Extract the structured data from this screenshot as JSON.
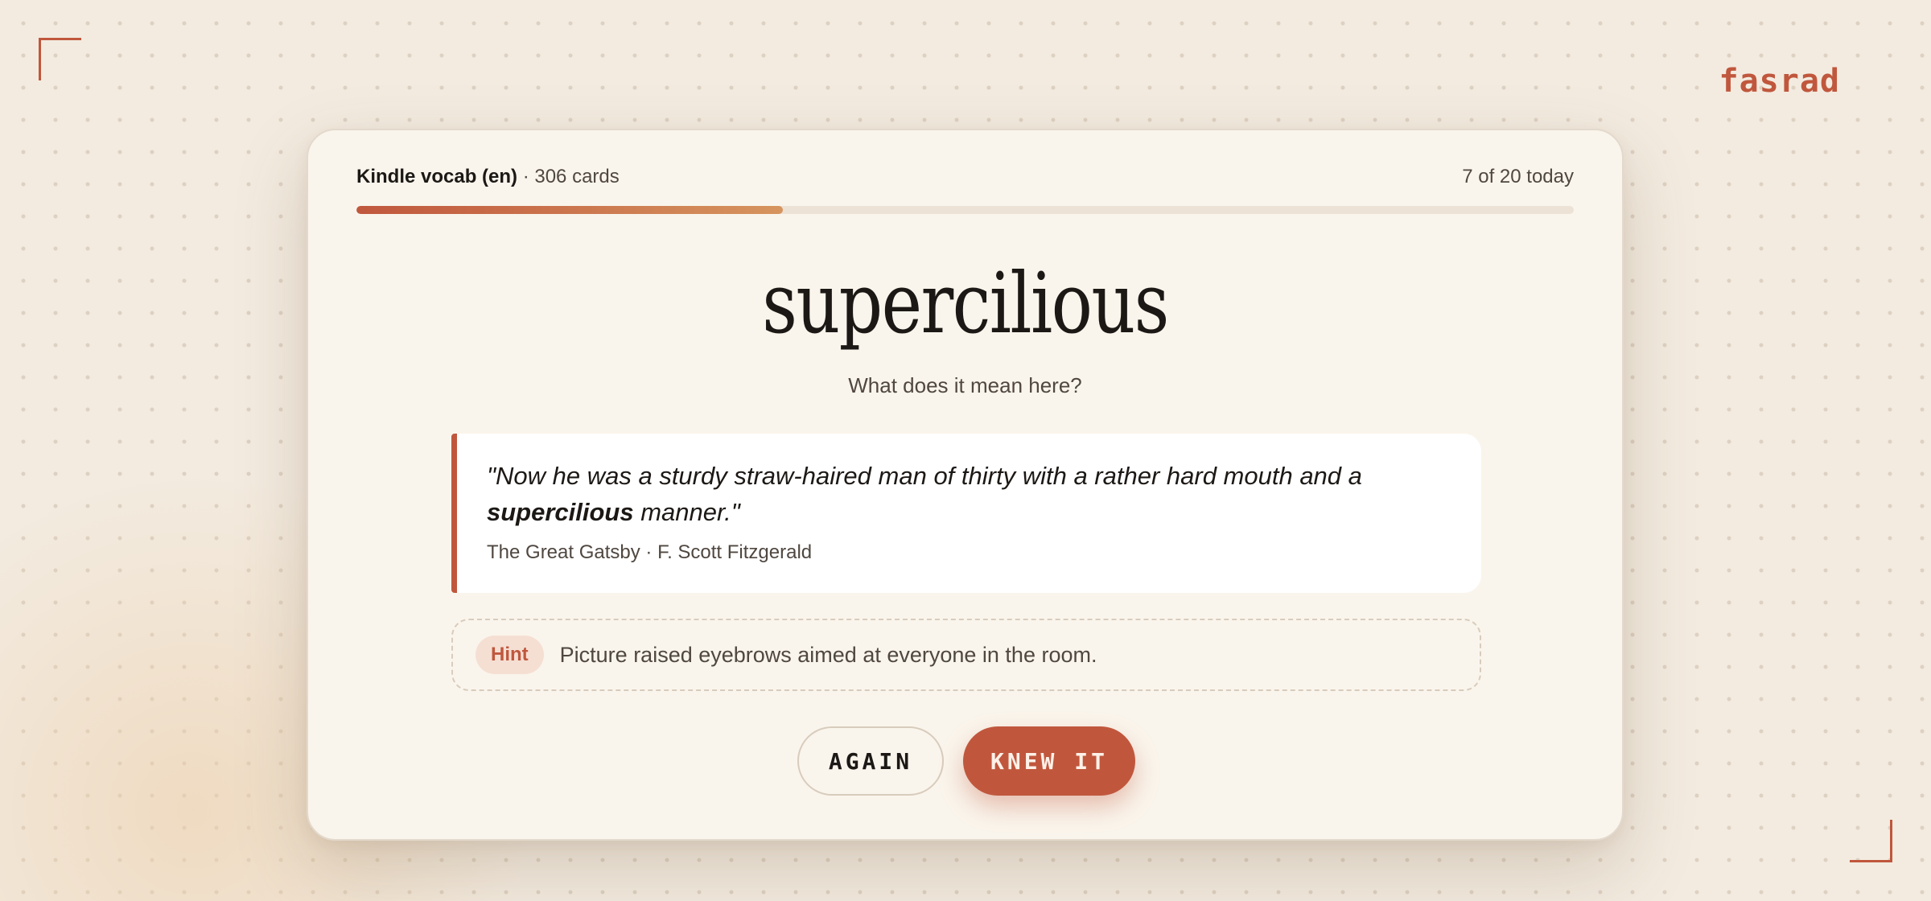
{
  "brand": {
    "name": "fasrad"
  },
  "deck": {
    "name": "Kindle vocab (en)",
    "card_count": "· 306 cards"
  },
  "progress": {
    "label": "7 of 20 today",
    "done": 7,
    "total": 20
  },
  "card": {
    "word": "supercilious",
    "prompt": "What does it mean here?",
    "quote": {
      "before": "\"Now he was a sturdy straw-haired man of thirty with a rather hard mouth and a ",
      "highlight": "supercilious",
      "after": " manner.\"",
      "source": "The Great Gatsby · F. Scott Fitzgerald"
    },
    "hint": {
      "badge": "Hint",
      "text": "Picture raised eyebrows aimed at everyone in the room."
    }
  },
  "actions": {
    "again_label": "AGAIN",
    "knew_label": "KNEW IT"
  },
  "colors": {
    "accent": "#c0573d",
    "background": "#f3ebe0",
    "card": "#faf5ec"
  }
}
